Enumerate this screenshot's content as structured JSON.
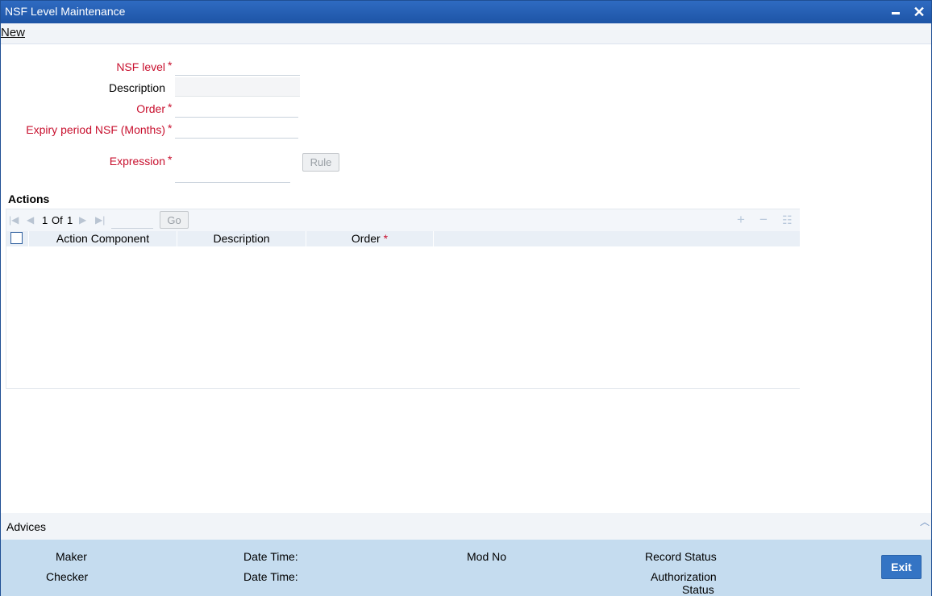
{
  "window": {
    "title": "NSF Level Maintenance",
    "minimize_icon": "minimize-icon",
    "close_icon": "close-icon"
  },
  "toolbar": {
    "new_label": "New"
  },
  "form": {
    "nsf_level": {
      "label": "NSF level",
      "value": ""
    },
    "description": {
      "label": "Description",
      "value": ""
    },
    "order": {
      "label": "Order",
      "value": ""
    },
    "expiry_period": {
      "label": "Expiry period NSF (Months)",
      "value": ""
    },
    "expression": {
      "label": "Expression",
      "value": ""
    },
    "required_marker": "*",
    "rule_button": "Rule"
  },
  "actions": {
    "title": "Actions",
    "pager": {
      "current": "1",
      "of_label": "Of",
      "total": "1",
      "go_label": "Go"
    },
    "columns": [
      "Action Component",
      "Description",
      "Order"
    ],
    "rows": []
  },
  "advices": {
    "label": "Advices"
  },
  "footer": {
    "maker": "Maker",
    "checker": "Checker",
    "date_time_1": "Date Time:",
    "date_time_2": "Date Time:",
    "mod_no": "Mod No",
    "record_status": "Record Status",
    "authorization_line1": "Authorization",
    "authorization_line2": "Status",
    "exit_label": "Exit"
  },
  "colors": {
    "title_bar": "#1d54a6",
    "required": "#c8102e",
    "footer_bg": "#c5dcef",
    "exit_button": "#3474c4"
  }
}
